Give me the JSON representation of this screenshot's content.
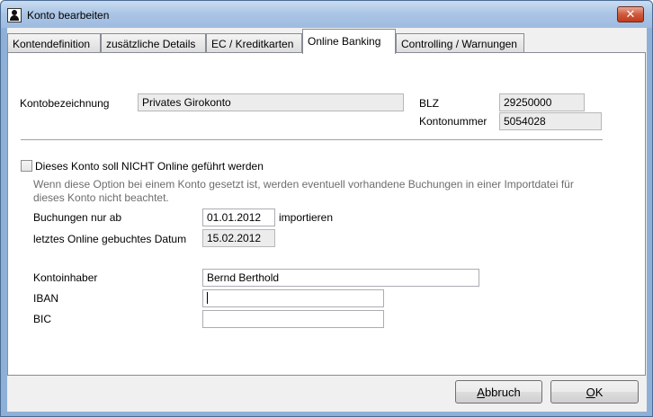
{
  "window": {
    "title": "Konto bearbeiten",
    "close_symbol": "✕"
  },
  "tabs": [
    {
      "label": "Kontendefinition"
    },
    {
      "label": "zusätzliche Details"
    },
    {
      "label": "EC / Kreditkarten"
    },
    {
      "label": "Online Banking",
      "active": true
    },
    {
      "label": "Controlling / Warnungen"
    }
  ],
  "account": {
    "name_label": "Kontobezeichnung",
    "name_value": "Privates Girokonto",
    "blz_label": "BLZ",
    "blz_value": "29250000",
    "number_label": "Kontonummer",
    "number_value": "5054028"
  },
  "online": {
    "checkbox_label": "Dieses Konto soll NICHT Online geführt werden",
    "checkbox_checked": false,
    "note_line1": "Wenn diese Option bei einem Konto gesetzt ist, werden eventuell vorhandene Buchungen in einer Importdatei für",
    "note_line2": "dieses Konto nicht beachtet.",
    "bookings_from_label": "Buchungen nur ab",
    "bookings_from_value": "01.01.2012",
    "import_label": "importieren",
    "last_date_label": "letztes Online gebuchtes Datum",
    "last_date_value": "15.02.2012"
  },
  "holder": {
    "owner_label": "Kontoinhaber",
    "owner_value": "Bernd Berthold",
    "iban_label": "IBAN",
    "iban_value": "",
    "bic_label": "BIC",
    "bic_value": ""
  },
  "buttons": {
    "cancel_first": "A",
    "cancel_rest": "bbruch",
    "ok_first": "O",
    "ok_rest": "K"
  },
  "icons": {
    "app": "user-icon",
    "close": "close-icon"
  },
  "colors": {
    "titlebar": "#a9c4e4",
    "close_button": "#cf5a3d",
    "panel": "#ffffff",
    "client": "#f0f0f0"
  }
}
